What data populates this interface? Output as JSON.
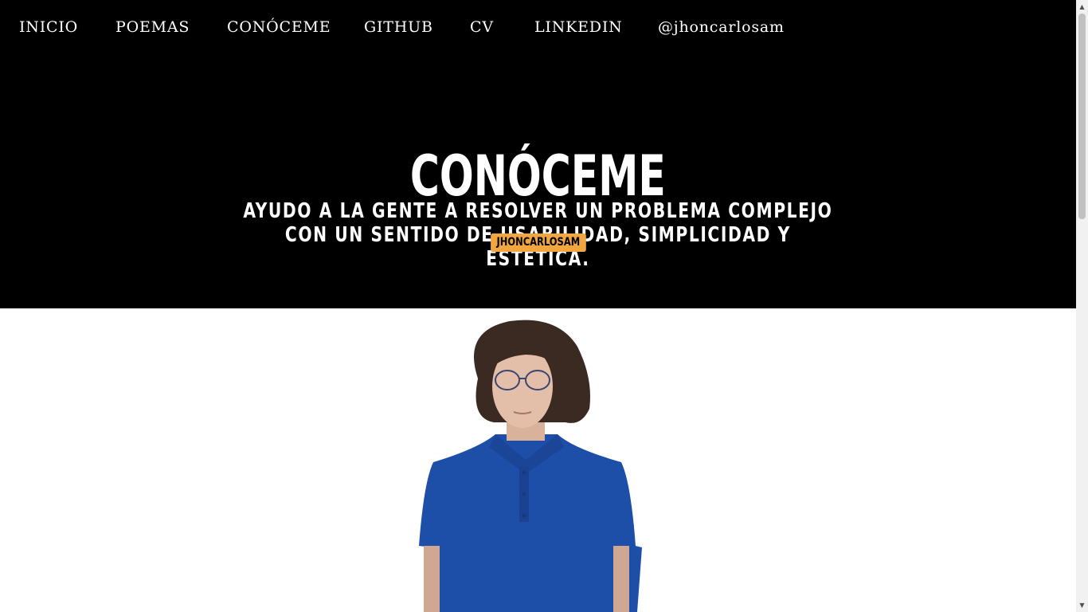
{
  "nav": {
    "items": [
      {
        "label": "INICIO"
      },
      {
        "label": "POEMAS"
      },
      {
        "label": "CONÓCEME"
      },
      {
        "label": "GITHUB"
      },
      {
        "label": "CV"
      },
      {
        "label": "LINKEDIN"
      },
      {
        "label": "@jhoncarlosam"
      }
    ]
  },
  "hero": {
    "title": "CONÓCEME",
    "subtitle": "AYUDO A LA GENTE A RESOLVER UN PROBLEMA COMPLEJO CON UN SENTIDO DE USABILIDAD, SIMPLICIDAD Y ESTÉTICA.",
    "tag": "JHONCARLOSAM",
    "tag_color": "#f2a640",
    "background": "#000000"
  },
  "scrollbar": {
    "up_icon": "triangle-up",
    "down_icon": "triangle-down"
  }
}
